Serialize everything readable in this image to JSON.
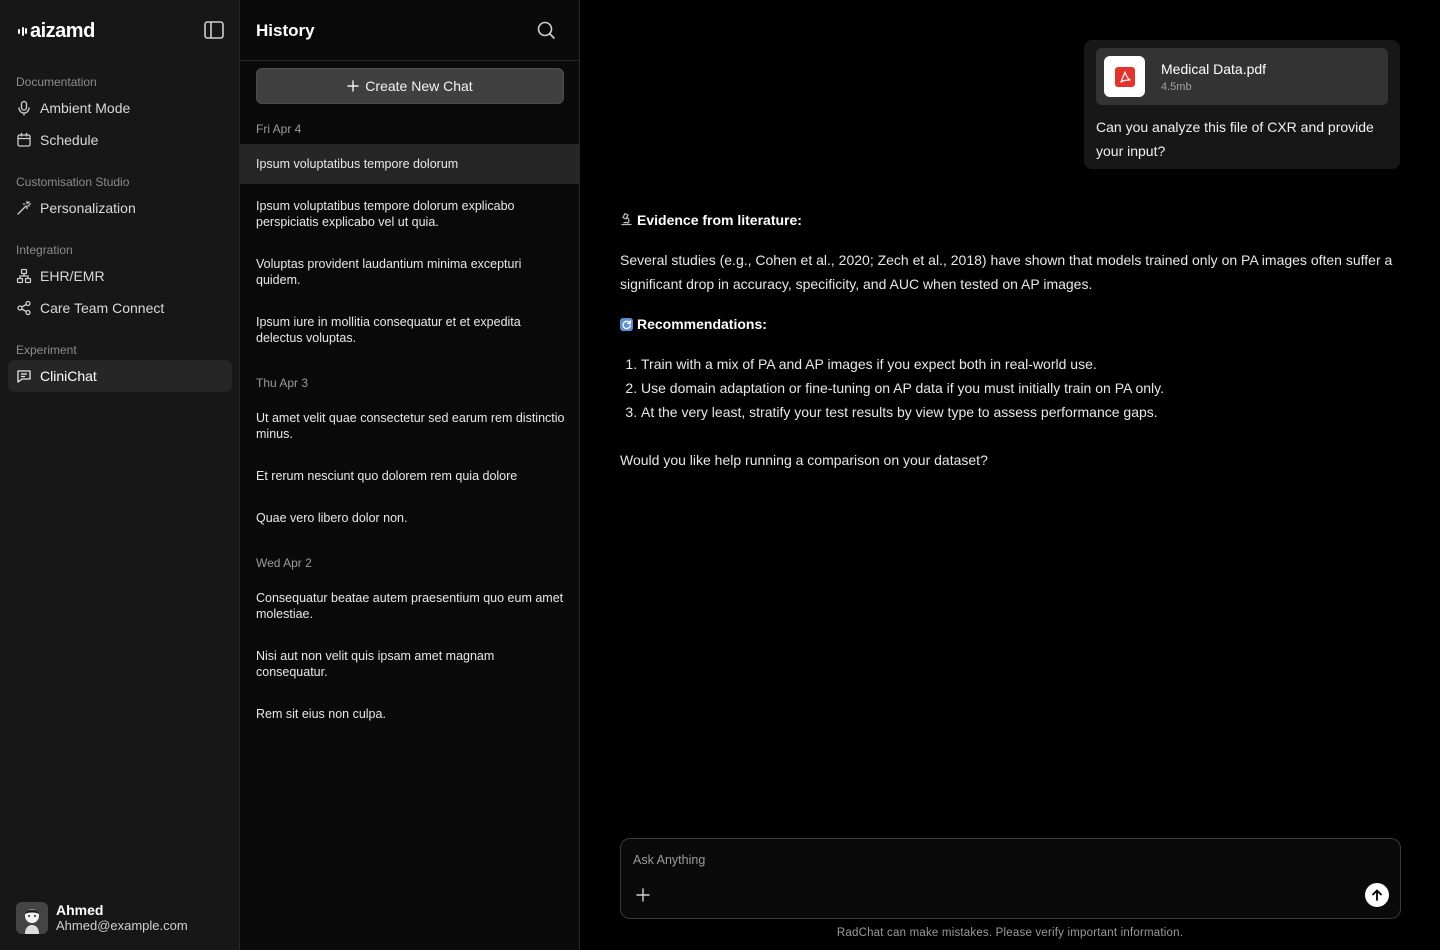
{
  "brand": {
    "name": "aizamd"
  },
  "sidebar": {
    "sections": [
      {
        "label": "Documentation",
        "items": [
          {
            "label": "Ambient Mode",
            "icon": "microphone-icon"
          },
          {
            "label": "Schedule",
            "icon": "calendar-icon"
          }
        ]
      },
      {
        "label": "Customisation Studio",
        "items": [
          {
            "label": "Personalization",
            "icon": "magic-wand-icon"
          }
        ]
      },
      {
        "label": "Integration",
        "items": [
          {
            "label": "EHR/EMR",
            "icon": "network-icon"
          },
          {
            "label": "Care Team Connect",
            "icon": "share-icon"
          }
        ]
      },
      {
        "label": "Experiment",
        "items": [
          {
            "label": "CliniChat",
            "icon": "chat-icon",
            "active": true
          }
        ]
      }
    ],
    "user": {
      "name": "Ahmed",
      "email": "Ahmed@example.com"
    }
  },
  "history": {
    "title": "History",
    "new_chat_label": "Create New Chat",
    "groups": [
      {
        "date": "Fri Apr 4",
        "items": [
          "Ipsum voluptatibus tempore dolorum",
          "Ipsum voluptatibus tempore dolorum explicabo perspiciatis explicabo vel ut quia.",
          "Voluptas provident laudantium minima excepturi quidem.",
          "Ipsum iure in mollitia consequatur et et expedita delectus voluptas."
        ]
      },
      {
        "date": "Thu Apr 3",
        "items": [
          "Ut amet velit quae consectetur sed earum rem distinctio minus.",
          "Et rerum nesciunt quo dolorem rem quia dolore",
          "Quae vero libero dolor non."
        ]
      },
      {
        "date": "Wed Apr 2",
        "items": [
          "Consequatur beatae autem praesentium quo eum amet molestiae.",
          "Nisi aut non velit quis ipsam amet magnam consequatur.",
          "Rem sit eius non culpa."
        ]
      }
    ]
  },
  "chat": {
    "user_message": {
      "file_name": "Medical Data.pdf",
      "file_size": "4.5mb",
      "text": "Can you analyze this file of CXR and provide your input?"
    },
    "reply": {
      "evidence_heading": "Evidence from literature:",
      "evidence_text": "Several studies (e.g., Cohen et al., 2020; Zech et al., 2018) have shown that models trained only on PA images often suffer a significant drop in accuracy, specificity, and AUC when tested on AP images.",
      "recommendations_heading": "Recommendations:",
      "recommendations": [
        "Train with a mix of PA and AP images if you expect both in real-world use.",
        "Use domain adaptation or fine-tuning on AP data if you must initially train on PA only.",
        "At the very least, stratify your test results by view type to assess performance gaps."
      ],
      "closing": "Would you like help running a comparison on your dataset?"
    },
    "input": {
      "placeholder": "Ask Anything",
      "value": ""
    },
    "disclaimer": "RadChat can make mistakes. Please verify important information."
  },
  "colors": {
    "pdf_red": "#e5322d",
    "active_bg": "#262626",
    "panel_bg": "#171717"
  }
}
